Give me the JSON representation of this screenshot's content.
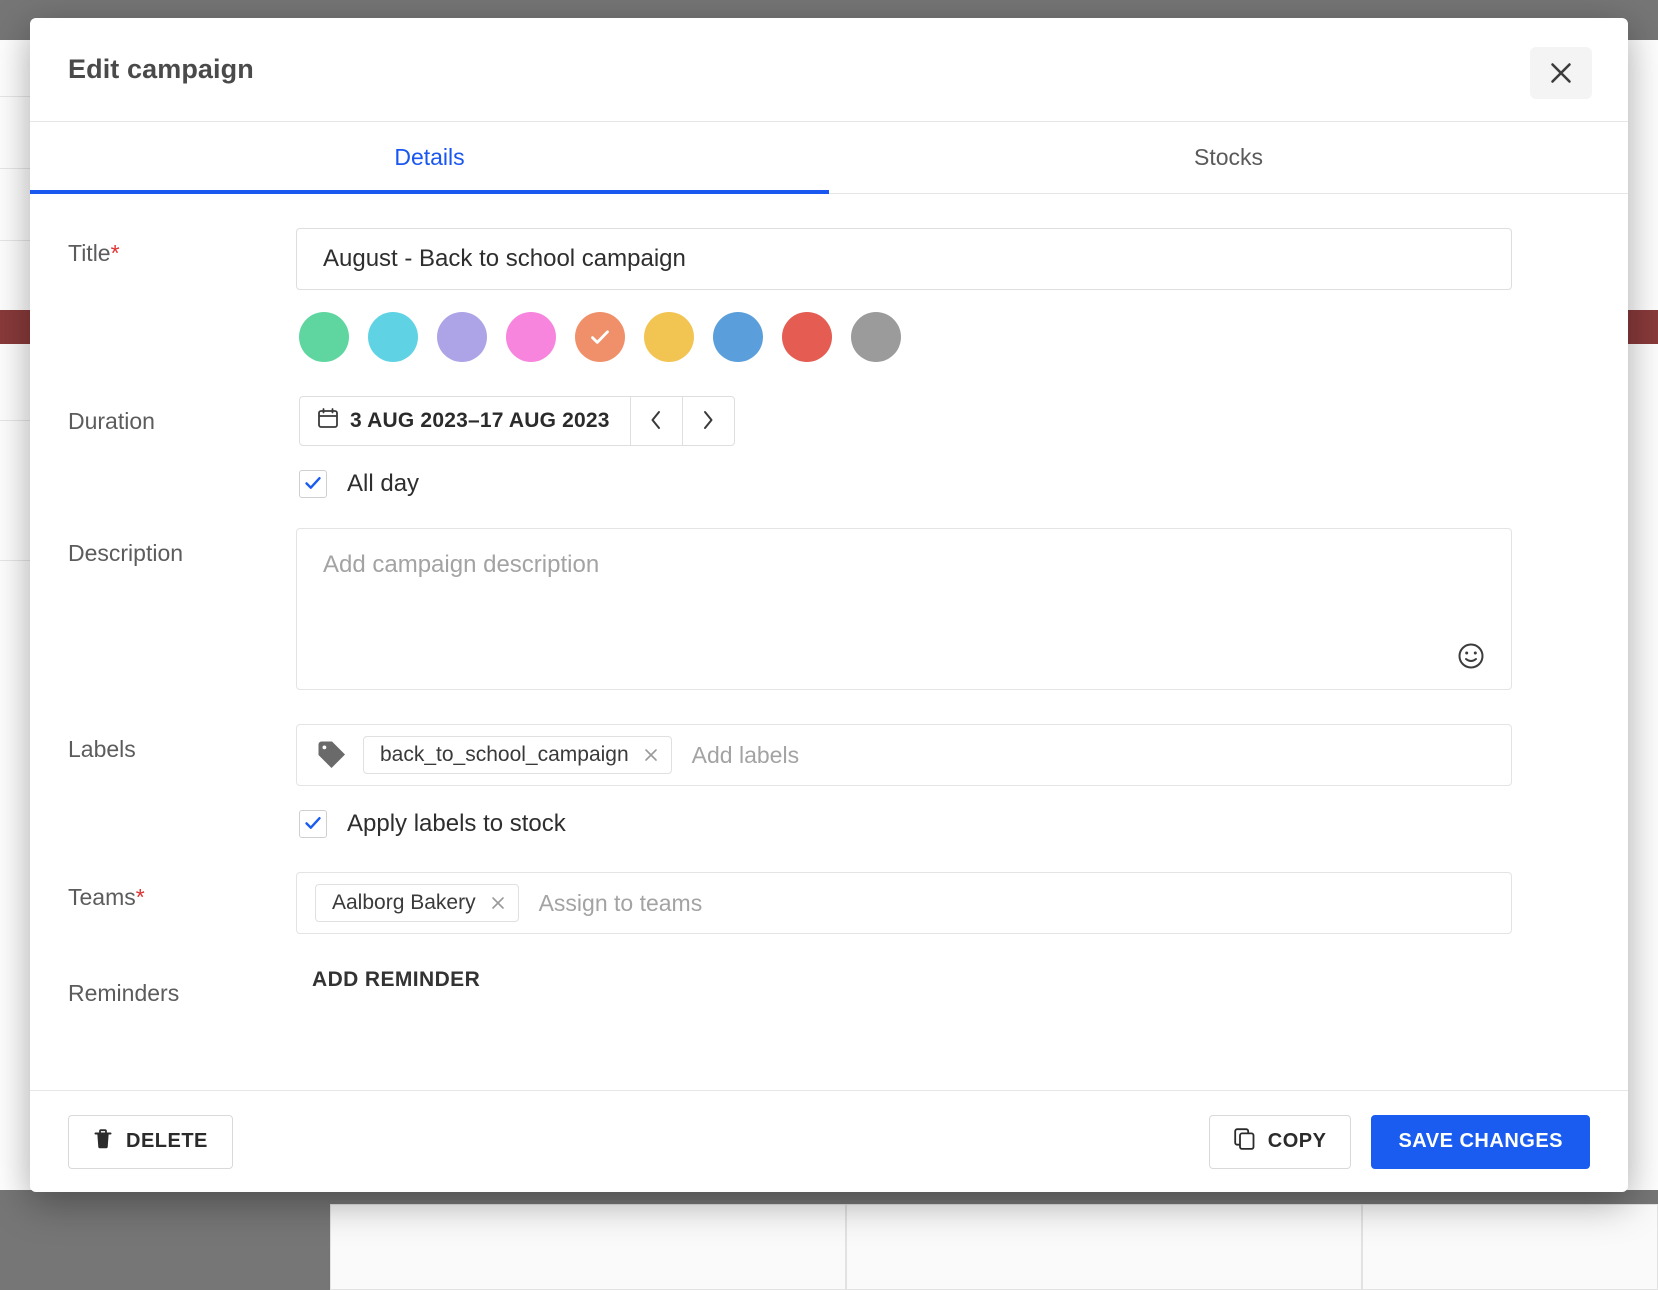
{
  "modal": {
    "title": "Edit campaign",
    "close_icon": "close-icon"
  },
  "tabs": [
    {
      "label": "Details",
      "active": true
    },
    {
      "label": "Stocks",
      "active": false
    }
  ],
  "form": {
    "title_field": {
      "label": "Title",
      "required_marker": "*",
      "value": "August - Back to school campaign"
    },
    "colors": {
      "selected_index": 4,
      "swatches": [
        "#5fd6a0",
        "#5fd3e4",
        "#aca4e6",
        "#f785dd",
        "#f0906b",
        "#f2c452",
        "#5a9fdb",
        "#e45c52",
        "#9b9b9b"
      ]
    },
    "duration": {
      "label": "Duration",
      "value": "3 AUG 2023–17 AUG 2023",
      "calendar_icon": "calendar-icon",
      "prev_label": "‹",
      "next_label": "›"
    },
    "all_day": {
      "label": "All day",
      "checked": true
    },
    "description": {
      "label": "Description",
      "value": "",
      "placeholder": "Add campaign description",
      "emoji_icon": "emoji-icon"
    },
    "labels": {
      "label": "Labels",
      "tag_icon": "tag-icon",
      "chips": [
        "back_to_school_campaign"
      ],
      "placeholder": "Add labels"
    },
    "apply_labels": {
      "label": "Apply labels to stock",
      "checked": true
    },
    "teams": {
      "label": "Teams",
      "required_marker": "*",
      "chips": [
        "Aalborg Bakery"
      ],
      "placeholder": "Assign to teams"
    },
    "reminders": {
      "label": "Reminders",
      "add_label": "ADD REMINDER"
    }
  },
  "footer": {
    "delete_label": "DELETE",
    "copy_label": "COPY",
    "save_label": "SAVE CHANGES",
    "accent_color": "#1a5cf0"
  }
}
